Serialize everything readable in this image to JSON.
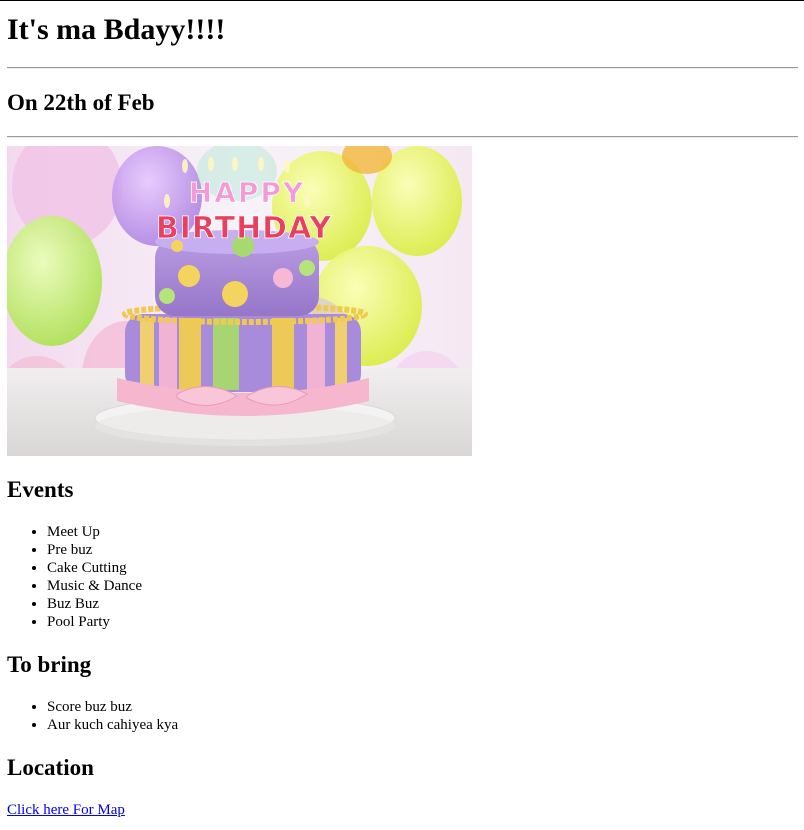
{
  "heading": "It's ma Bdayy!!!!",
  "date_heading": "On 22th of Feb",
  "image": {
    "alt": "Birthday cake",
    "candles_text": [
      "HAPPY",
      "BIRTHDAY"
    ]
  },
  "events": {
    "title": "Events",
    "items": [
      "Meet Up",
      "Pre buz",
      "Cake Cutting",
      "Music & Dance",
      "Buz Buz",
      "Pool Party"
    ]
  },
  "bring": {
    "title": "To bring",
    "items": [
      "Score buz buz",
      "Aur kuch cahiyea kya"
    ]
  },
  "location": {
    "title": "Location",
    "link_text": "Click here For Map"
  },
  "colors": {
    "link": "#0000ee",
    "rule": "#9a9a9a"
  }
}
